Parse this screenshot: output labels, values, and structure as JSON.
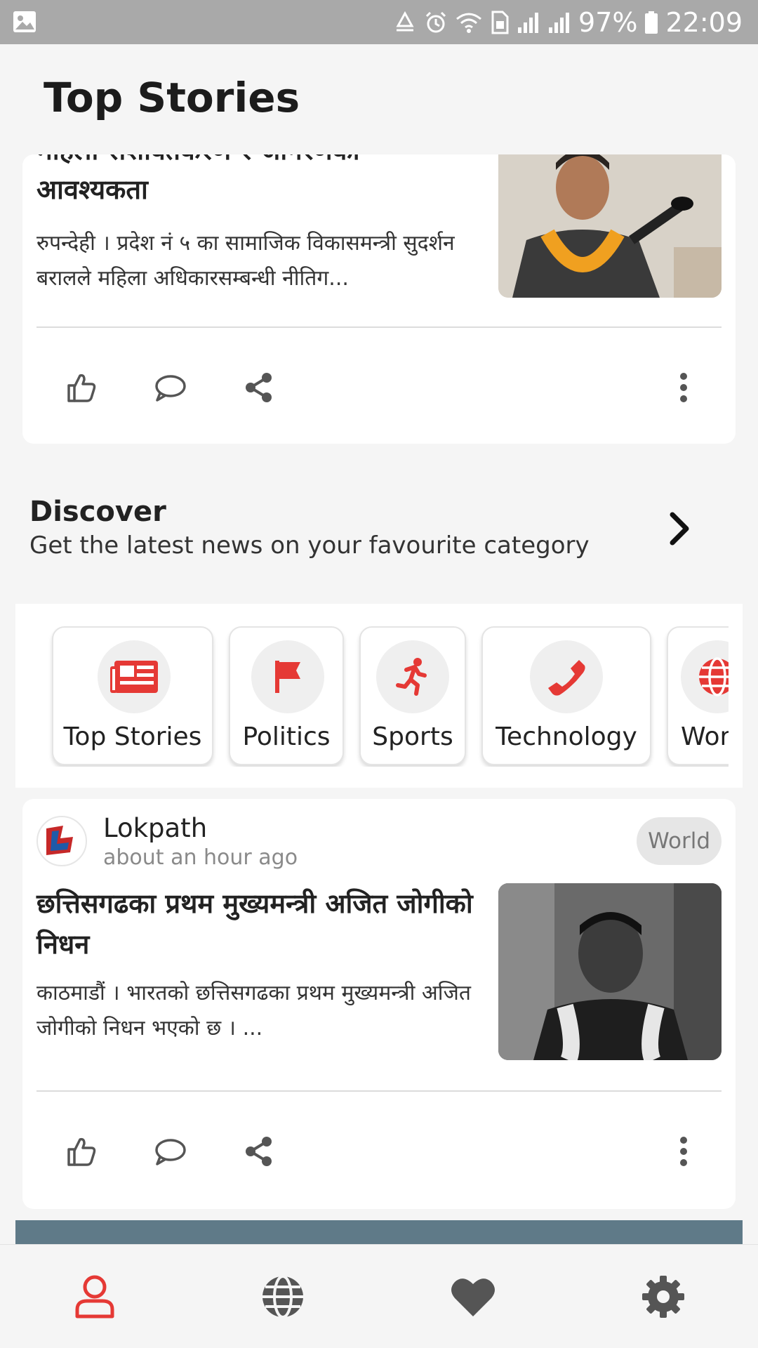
{
  "status_bar": {
    "battery": "97%",
    "time": "22:09",
    "icons": [
      "gallery-icon",
      "recycle-icon",
      "alarm-icon",
      "wifi-icon",
      "sim-icon",
      "signal-icon",
      "signal-icon",
      "battery-icon"
    ]
  },
  "header": {
    "title": "Top Stories"
  },
  "cards": [
    {
      "headline_partial": "महिला सशक्तिकरण र जागरणको",
      "headline": "आवश्यकता",
      "summary": "रुपन्देही । प्रदेश नं ५ का सामाजिक विकासमन्त्री सुदर्शन बरालले महिला अधिकारसम्बन्धी नीतिग...",
      "actions": [
        "thumbs-up-icon",
        "comment-icon",
        "share-icon",
        "more-vertical-icon"
      ]
    },
    {
      "source": "Lokpath",
      "time": "about an hour ago",
      "tag": "World",
      "headline": "छत्तिसगढका प्रथम मुख्यमन्त्री अजित जोगीको निधन",
      "summary": "काठमाडौं । भारतको छत्तिसगढका प्रथम मुख्यमन्त्री अजित जोगीको निधन भएको छ । ...",
      "actions": [
        "thumbs-up-icon",
        "comment-icon",
        "share-icon",
        "more-vertical-icon"
      ]
    }
  ],
  "discover": {
    "title": "Discover",
    "subtitle": "Get the latest news on your favourite category",
    "categories": [
      {
        "label": "Top Stories",
        "icon": "newspaper-icon"
      },
      {
        "label": "Politics",
        "icon": "flag-icon"
      },
      {
        "label": "Sports",
        "icon": "running-icon"
      },
      {
        "label": "Technology",
        "icon": "phone-icon"
      },
      {
        "label": "World",
        "icon": "globe-icon"
      }
    ]
  },
  "bottom_nav": {
    "items": [
      "profile-icon",
      "globe-icon",
      "heart-icon",
      "settings-icon"
    ],
    "active": "profile-icon"
  },
  "colors": {
    "accent": "#e53935",
    "icon_gray": "#555555",
    "status_bar": "#a9a9a9",
    "banner": "#5f7a88"
  }
}
